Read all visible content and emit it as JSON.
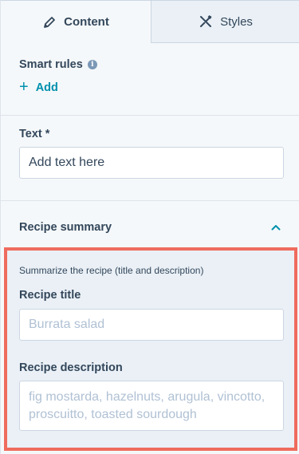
{
  "tabs": [
    {
      "label": "Content",
      "icon": "pencil-icon",
      "active": true
    },
    {
      "label": "Styles",
      "icon": "styles-brush-icon",
      "active": false
    }
  ],
  "smart_rules": {
    "label": "Smart rules",
    "info_icon": "info-icon",
    "add_label": "Add"
  },
  "text_field": {
    "label": "Text *",
    "placeholder": "Add text here"
  },
  "recipe_summary": {
    "title": "Recipe summary",
    "expanded": true,
    "help_text": "Summarize the recipe (title and description)",
    "recipe_title": {
      "label": "Recipe title",
      "placeholder": "Burrata salad"
    },
    "recipe_description": {
      "label": "Recipe description",
      "placeholder": "fig mostarda, hazelnuts, arugula, vincotto, proscuitto, toasted sourdough"
    }
  },
  "colors": {
    "accent": "#0091ae",
    "highlight_border": "#ef6b5e",
    "text": "#33475b",
    "placeholder": "#b0c1d4"
  }
}
